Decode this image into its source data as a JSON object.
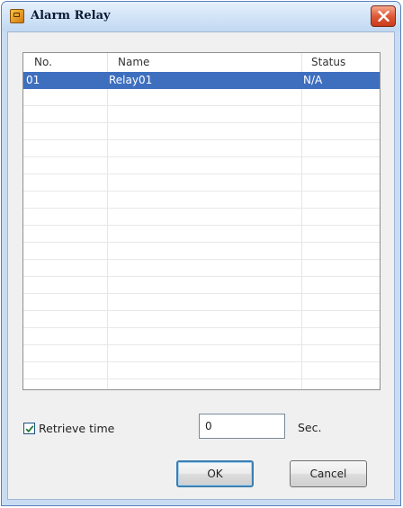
{
  "window": {
    "title": "Alarm Relay"
  },
  "table": {
    "columns": [
      "No.",
      "Name",
      "Status"
    ],
    "rows": [
      {
        "no": "01",
        "name": "Relay01",
        "status": "N/A",
        "selected": true
      }
    ],
    "empty_rows": 17
  },
  "retrieve": {
    "checkbox_label": "Retrieve time",
    "checked": true,
    "value": "0",
    "unit": "Sec."
  },
  "buttons": {
    "ok_label": "OK",
    "cancel_label": "Cancel"
  },
  "colors": {
    "selection": "#3e6fbf",
    "close_button": "#de5a38",
    "title_bar": "#d4e5f8"
  },
  "icons": {
    "app": "alarm-relay-app-icon",
    "close": "close-icon",
    "check": "checkmark-icon"
  }
}
